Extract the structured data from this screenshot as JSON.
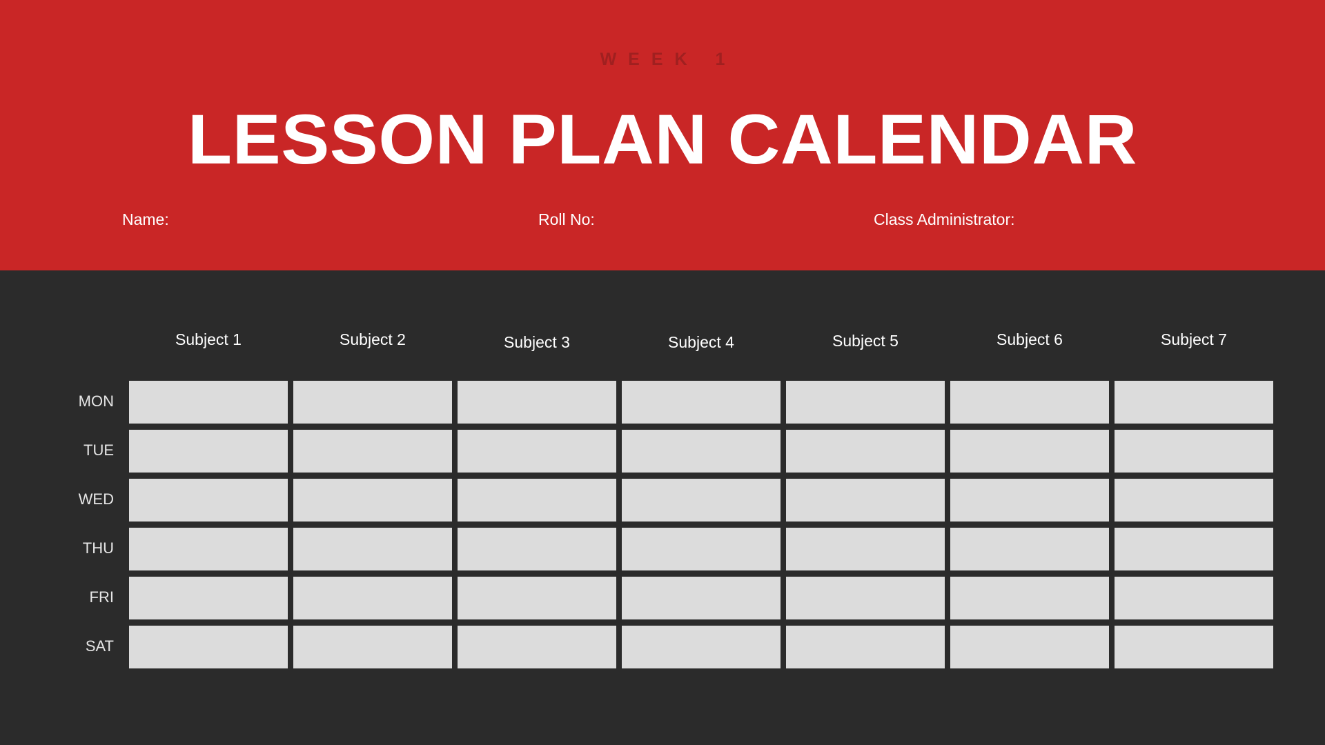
{
  "header": {
    "eyebrow": "WEEK 1",
    "title": "LESSON PLAN CALENDAR",
    "background_color": "#c92626",
    "eyebrow_color": "#a02020",
    "fields": [
      {
        "label": "Name:"
      },
      {
        "label": "Roll No:"
      },
      {
        "label": "Class Administrator:"
      }
    ]
  },
  "calendar": {
    "background_color": "#2b2b2b",
    "cell_color": "#dcdcdc",
    "subjects": [
      "Subject 1",
      "Subject 2",
      "Subject 3",
      "Subject 4",
      "Subject 5",
      "Subject 6",
      "Subject 7"
    ],
    "days": [
      "MON",
      "TUE",
      "WED",
      "THU",
      "FRI",
      "SAT"
    ],
    "cells": [
      [
        "",
        "",
        "",
        "",
        "",
        "",
        ""
      ],
      [
        "",
        "",
        "",
        "",
        "",
        "",
        ""
      ],
      [
        "",
        "",
        "",
        "",
        "",
        "",
        ""
      ],
      [
        "",
        "",
        "",
        "",
        "",
        "",
        ""
      ],
      [
        "",
        "",
        "",
        "",
        "",
        "",
        ""
      ],
      [
        "",
        "",
        "",
        "",
        "",
        "",
        ""
      ]
    ]
  }
}
